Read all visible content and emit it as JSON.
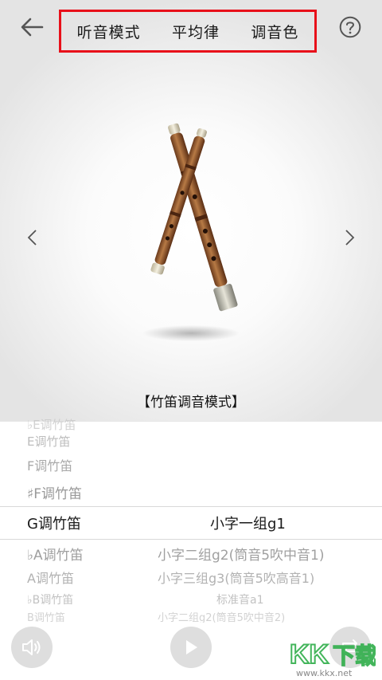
{
  "header": {
    "tabs": [
      {
        "label": "听音模式"
      },
      {
        "label": "平均律"
      },
      {
        "label": "调音色"
      }
    ],
    "highlight_color": "#e8101a"
  },
  "hero": {
    "caption": "【竹笛调音模式】"
  },
  "picker": {
    "rows": [
      {
        "key": "♭E调竹笛",
        "note": ""
      },
      {
        "key": "E调竹笛",
        "note": ""
      },
      {
        "key": "F调竹笛",
        "note": ""
      },
      {
        "key": "♯F调竹笛",
        "note": ""
      },
      {
        "key": "G调竹笛",
        "note": "小字一组g1"
      },
      {
        "key": "♭A调竹笛",
        "note": "小字二组g2(筒音5吹中音1)"
      },
      {
        "key": "A调竹笛",
        "note": "小字三组g3(筒音5吹高音1)"
      },
      {
        "key": "♭B调竹笛",
        "note": "标准音a1"
      },
      {
        "key": "B调竹笛",
        "note": "小字二组g2(筒音5吹中音2)"
      }
    ],
    "selected_index": 4
  },
  "watermark": {
    "logo": "KK下载",
    "url": "www.kkx.net"
  },
  "icons": {
    "back": "back-arrow-icon",
    "help": "help-circle-icon",
    "prev": "chevron-left-icon",
    "next": "chevron-right-icon",
    "volume": "speaker-icon",
    "play": "play-icon",
    "loop": "loop-icon"
  }
}
